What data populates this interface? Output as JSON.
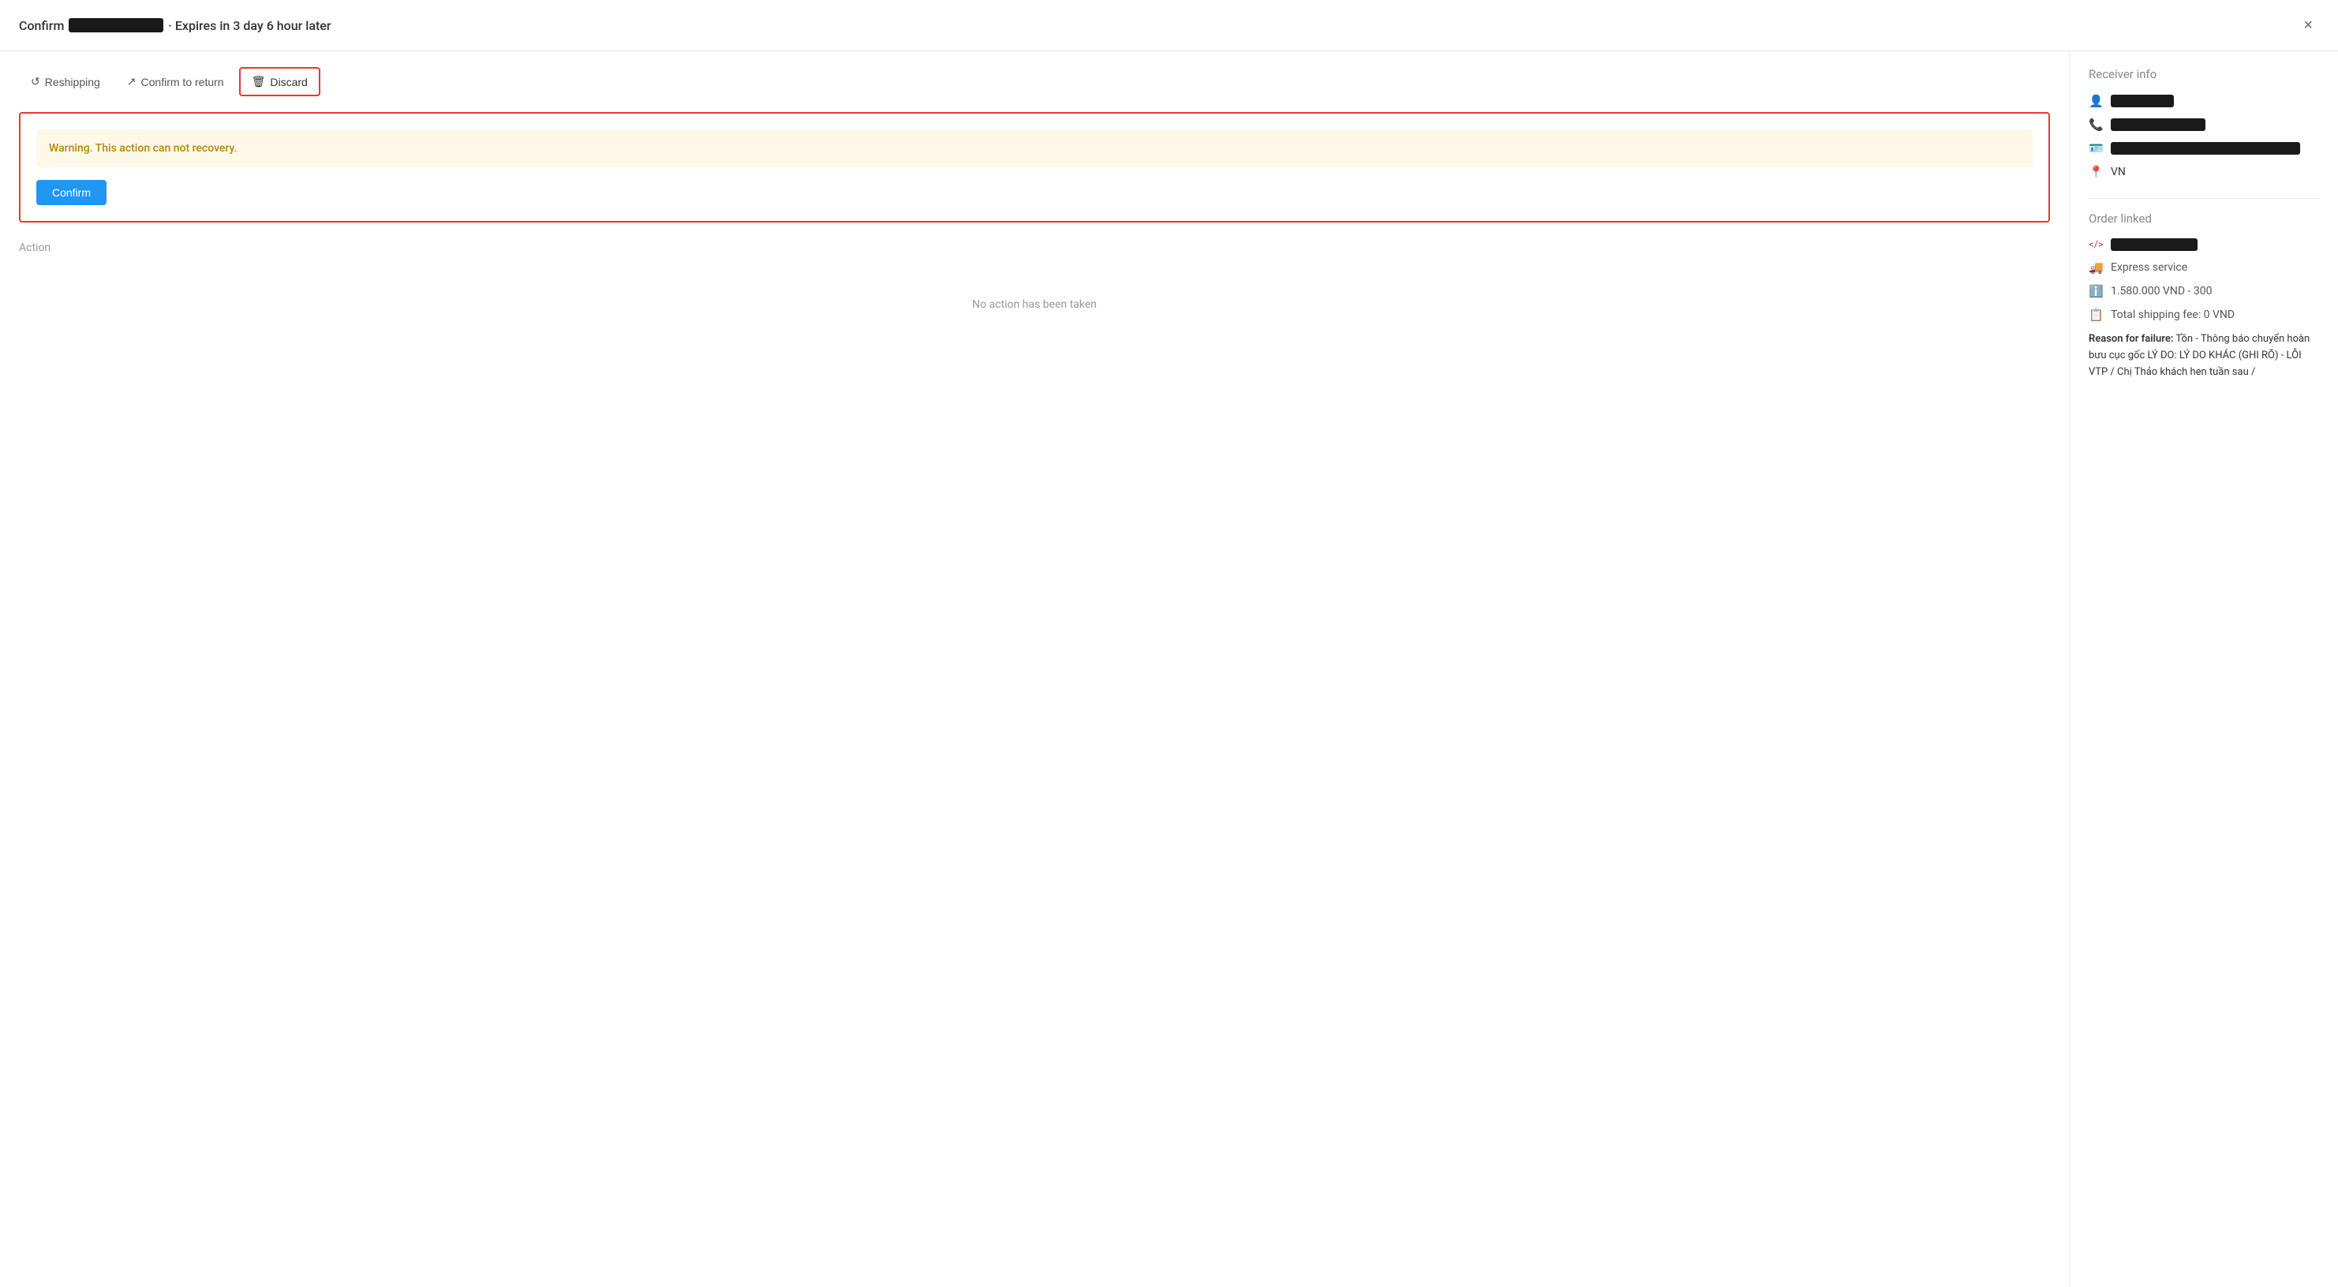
{
  "header": {
    "title_prefix": "Confirm",
    "title_id_redacted": true,
    "title_suffix": "· Expires in 3 day 6 hour later",
    "close_label": "×"
  },
  "tabs": [
    {
      "id": "reshipping",
      "icon": "↺",
      "label": "Reshipping",
      "active": false
    },
    {
      "id": "confirm-return",
      "icon": "↗",
      "label": "Confirm to return",
      "active": false
    },
    {
      "id": "discard",
      "icon": "🗑",
      "label": "Discard",
      "active": true
    }
  ],
  "discard_panel": {
    "warning_text": "Warning. This action can not recovery.",
    "confirm_button_label": "Confirm"
  },
  "action_section": {
    "label": "Action",
    "empty_text": "No action has been taken"
  },
  "sidebar": {
    "receiver_section_title": "Receiver info",
    "order_section_title": "Order linked",
    "receiver": {
      "name_redacted": true,
      "phone_redacted": true,
      "address_redacted": true,
      "country": "VN"
    },
    "order": {
      "id_prefix": "</>",
      "id_redacted": true,
      "service_icon": "🚚",
      "service": "Express service",
      "info_icon": "ℹ",
      "amount": "1.580.000 VND - 300",
      "shipping_icon": "📋",
      "shipping_fee": "Total shipping fee: 0 VND",
      "reason_label": "Reason for failure:",
      "reason_text": "Tồn - Thông báo chuyển hoàn bưu cục gốc LÝ DO: LÝ DO KHÁC (GHI RÕ) - LỖI VTP / Chị Thảo khách hen tuần sau /"
    }
  }
}
